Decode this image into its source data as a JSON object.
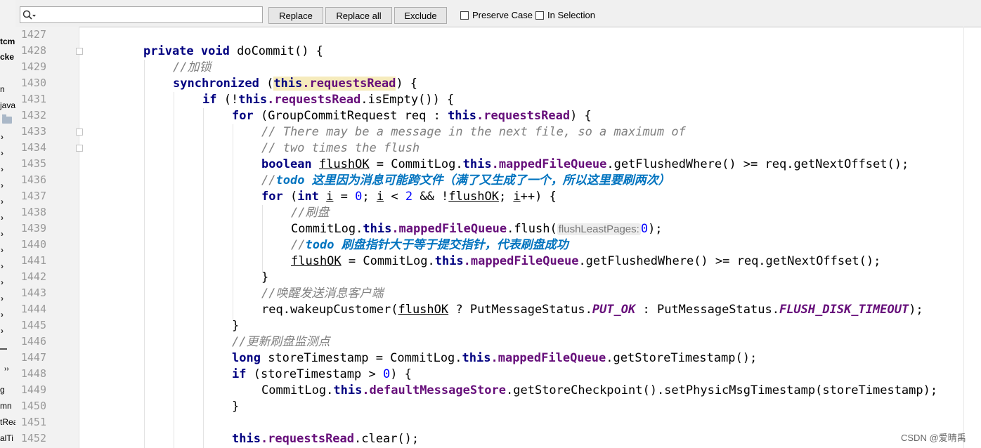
{
  "find_bar": {
    "search_value": "",
    "search_icon": "search-icon",
    "replace_label": "Replace",
    "replace_all_label": "Replace all",
    "exclude_label": "Exclude",
    "preserve_case_label": "Preserve Case",
    "in_selection_label": "In Selection"
  },
  "left_panel": {
    "fragments": [
      "tcmd",
      "cke",
      "n",
      "java",
      "g",
      "mn",
      "tRea",
      "alTi"
    ]
  },
  "editor": {
    "line_numbers": [
      "1427",
      "1428",
      "1429",
      "1430",
      "1431",
      "1432",
      "1433",
      "1434",
      "1435",
      "1436",
      "1437",
      "1438",
      "1439",
      "1440",
      "1441",
      "1442",
      "1443",
      "1444",
      "1445",
      "1446",
      "1447",
      "1448",
      "1449",
      "1450",
      "1451",
      "1452"
    ],
    "code": {
      "l1428": {
        "kw_private": "private",
        "kw_void": "void",
        "method": " doCommit() {"
      },
      "l1429": {
        "comment": "//加锁"
      },
      "l1430": {
        "kw": "synchronized",
        "open": " (",
        "kw_this": "this",
        "field": ".requestsRead",
        "close": ") {"
      },
      "l1431": {
        "kw_if": "if",
        "a": " (!",
        "kw_this": "this",
        "field": ".requestsRead",
        "b": ".isEmpty()) {"
      },
      "l1432": {
        "kw_for": "for",
        "a": " (GroupCommitRequest req : ",
        "kw_this": "this",
        "field": ".requestsRead",
        "b": ") {"
      },
      "l1433": {
        "comment": "// There may be a message in the next file, so a maximum of"
      },
      "l1434": {
        "comment": "// two times the flush"
      },
      "l1435": {
        "kw": "boolean",
        "sp": " ",
        "var": "flushOK",
        "a": " = CommitLog.",
        "kw_this": "this",
        "field": ".mappedFileQueue",
        "b": ".getFlushedWhere() >= req.getNextOffset();"
      },
      "l1436": {
        "prefix": "//",
        "todo": "todo 这里因为消息可能跨文件（满了又生成了一个，所以这里要刷两次）"
      },
      "l1437": {
        "kw_for": "for",
        "a": " (",
        "kw_int": "int",
        "sp1": " ",
        "i1": "i",
        "eq": " = ",
        "n0": "0",
        "semi1": "; ",
        "i2": "i",
        "lt": " < ",
        "n2": "2",
        "and": " && !",
        "var": "flushOK",
        "semi2": "; ",
        "i3": "i",
        "tail": "++) {"
      },
      "l1438": {
        "comment": "//刷盘"
      },
      "l1439": {
        "a": "CommitLog.",
        "kw_this": "this",
        "field": ".mappedFileQueue",
        "b": ".flush(",
        "hint": "flushLeastPages:",
        "n0": "0",
        "c": ");"
      },
      "l1440": {
        "prefix": "//",
        "todo": "todo 刷盘指针大于等于提交指针，代表刷盘成功"
      },
      "l1441": {
        "var": "flushOK",
        "a": " = CommitLog.",
        "kw_this": "this",
        "field": ".mappedFileQueue",
        "b": ".getFlushedWhere() >= req.getNextOffset();"
      },
      "l1442": {
        "brace": "}"
      },
      "l1443": {
        "comment": "//唤醒发送消息客户端"
      },
      "l1444": {
        "a": "req.wakeupCustomer(",
        "var": "flushOK",
        "b": " ? PutMessageStatus.",
        "c1": "PUT_OK",
        "c": " : PutMessageStatus.",
        "c2": "FLUSH_DISK_TIMEOUT",
        "d": ");"
      },
      "l1445": {
        "brace": "}"
      },
      "l1446": {
        "comment": "//更新刷盘监测点"
      },
      "l1447": {
        "kw": "long",
        "a": " storeTimestamp = CommitLog.",
        "kw_this": "this",
        "field": ".mappedFileQueue",
        "b": ".getStoreTimestamp();"
      },
      "l1448": {
        "kw_if": "if",
        "a": " (storeTimestamp > ",
        "n0": "0",
        "b": ") {"
      },
      "l1449": {
        "a": "CommitLog.",
        "kw_this": "this",
        "field": ".defaultMessageStore",
        "b": ".getStoreCheckpoint().setPhysicMsgTimestamp(storeTimestamp);"
      },
      "l1450": {
        "brace": "}"
      },
      "l1452": {
        "kw_this": "this",
        "field": ".requestsRead",
        "b": ".clear();"
      }
    }
  },
  "watermark": "CSDN @爱晴禹",
  "colors": {
    "keyword": "#000080",
    "field": "#660e7a",
    "comment": "#808080",
    "todo": "#0073bf",
    "number": "#0000ff",
    "highlight": "#f6ebbc"
  }
}
